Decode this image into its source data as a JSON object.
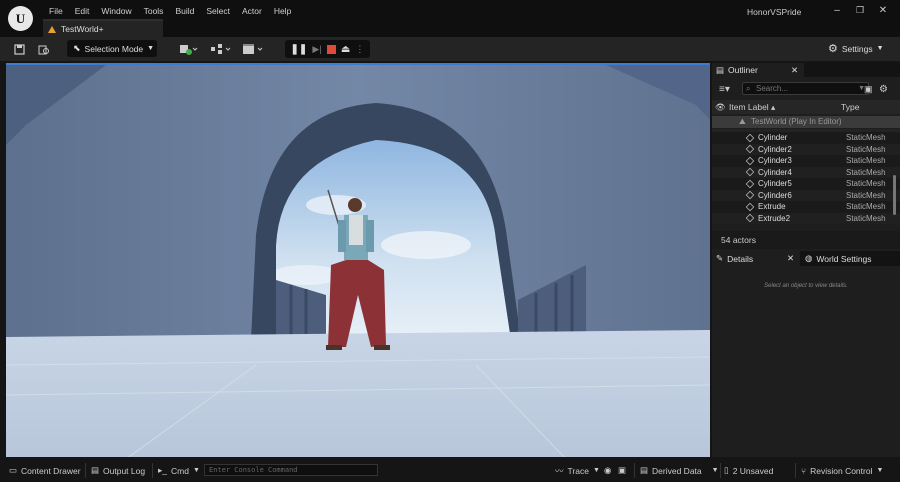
{
  "app": {
    "project_name": "HonorVSPride"
  },
  "menu": [
    "File",
    "Edit",
    "Window",
    "Tools",
    "Build",
    "Select",
    "Actor",
    "Help"
  ],
  "tab": {
    "label": "TestWorld+"
  },
  "toolbar": {
    "selection_mode": "Selection Mode",
    "settings_label": "Settings"
  },
  "outliner": {
    "tab_label": "Outliner",
    "search_placeholder": "Search...",
    "col_label": "Item Label ▴",
    "col_type": "Type",
    "world_row": "TestWorld (Play In Editor)",
    "rows": [
      {
        "label": "Cylinder",
        "type": "StaticMesh"
      },
      {
        "label": "Cylinder2",
        "type": "StaticMesh"
      },
      {
        "label": "Cylinder3",
        "type": "StaticMesh"
      },
      {
        "label": "Cylinder4",
        "type": "StaticMesh"
      },
      {
        "label": "Cylinder5",
        "type": "StaticMesh"
      },
      {
        "label": "Cylinder6",
        "type": "StaticMesh"
      },
      {
        "label": "Extrude",
        "type": "StaticMesh"
      },
      {
        "label": "Extrude2",
        "type": "StaticMesh"
      }
    ],
    "actor_count": "54 actors"
  },
  "details": {
    "tab_label": "Details",
    "world_settings_label": "World Settings",
    "empty_text": "Select an object to view details."
  },
  "statusbar": {
    "content_drawer": "Content Drawer",
    "output_log": "Output Log",
    "cmd": "Cmd",
    "console_placeholder": "Enter Console Command",
    "trace": "Trace",
    "derived_data": "Derived Data",
    "unsaved": "2 Unsaved",
    "revision_control": "Revision Control"
  },
  "colors": {
    "accent": "#3a7bd5",
    "stop": "#e04a3a",
    "warning": "#e8a030"
  }
}
